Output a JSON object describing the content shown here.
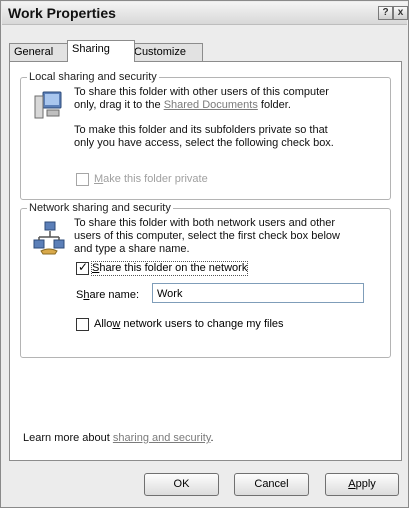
{
  "window": {
    "title": "Work Properties",
    "help_icon": "?",
    "close_icon": "x"
  },
  "tabs": [
    {
      "label": "General"
    },
    {
      "label": "Sharing"
    },
    {
      "label": "Customize"
    }
  ],
  "local": {
    "title": "Local sharing and security",
    "icon": "computer-icon",
    "text1": "To share this folder with other users of this computer",
    "text2_pre": "only, drag it to the ",
    "text2_link": "Shared Documents",
    "text2_post": " folder.",
    "text3": "To make this folder and its subfolders private so that",
    "text4": "only you have access, select the following check box.",
    "private_checkbox": {
      "mnemonic": "M",
      "label_rest": "ake this folder private",
      "checked": false,
      "enabled": false
    }
  },
  "network": {
    "title": "Network sharing and security",
    "icon": "network-share-icon",
    "text1": "To share this folder with both network users and other",
    "text2": "users of this computer, select the first check box below",
    "text3": "and type a share name.",
    "share_checkbox": {
      "mnemonic": "S",
      "label_rest": "hare this folder on the network",
      "checked": true
    },
    "share_name_label_pre": "S",
    "share_name_label_mn": "h",
    "share_name_label_post": "are name:",
    "share_name_value": "Work",
    "allow_checkbox": {
      "label_pre": "Allo",
      "mnemonic": "w",
      "label_rest": " network users to change my files",
      "checked": false
    }
  },
  "footer": {
    "learn_pre": "Learn more about ",
    "learn_link": "sharing and security",
    "learn_post": "."
  },
  "buttons": {
    "ok": "OK",
    "cancel": "Cancel",
    "apply_mn": "A",
    "apply_rest": "pply"
  }
}
